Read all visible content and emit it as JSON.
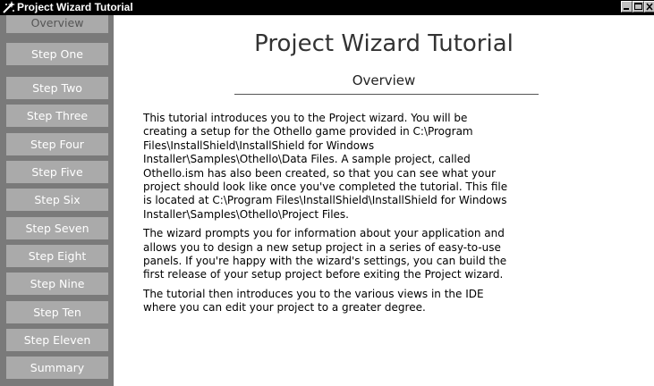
{
  "window": {
    "title": "Project Wizard Tutorial",
    "icon": "wizard-app-icon"
  },
  "sidebar": {
    "items": [
      {
        "label": "Overview",
        "active": true
      },
      {
        "label": "Step One"
      },
      {
        "label": "Step Two"
      },
      {
        "label": "Step Three"
      },
      {
        "label": "Step Four"
      },
      {
        "label": "Step Five"
      },
      {
        "label": "Step Six"
      },
      {
        "label": "Step Seven"
      },
      {
        "label": "Step Eight"
      },
      {
        "label": "Step Nine"
      },
      {
        "label": "Step Ten"
      },
      {
        "label": "Step Eleven"
      },
      {
        "label": "Summary"
      }
    ]
  },
  "main": {
    "title": "Project Wizard Tutorial",
    "section": "Overview",
    "paragraphs": [
      "This tutorial introduces you to the Project wizard. You will be\ncreating a setup for the Othello game provided in C:\\Program\nFiles\\InstallShield\\InstallShield for Windows\nInstaller\\Samples\\Othello\\Data Files. A sample project, called\nOthello.ism has also been created, so that you can see what your\nproject should look like once you've completed the tutorial. This file\nis located at C:\\Program Files\\InstallShield\\InstallShield for Windows\nInstaller\\Samples\\Othello\\Project Files.",
      "The wizard prompts you for information about your application and\nallows you to design a new setup project in a series of easy-to-use\npanels. If you're happy with the wizard's settings, you can build the\nfirst release of your setup project before exiting the Project wizard.",
      "The tutorial then introduces you to the various views in the IDE\nwhere you can edit your project to a greater degree."
    ]
  },
  "colors": {
    "titlebar": "#000000",
    "sidebar": "#7a7a7a",
    "nav_button": "#aaaaaa",
    "nav_text": "#ffffff"
  }
}
